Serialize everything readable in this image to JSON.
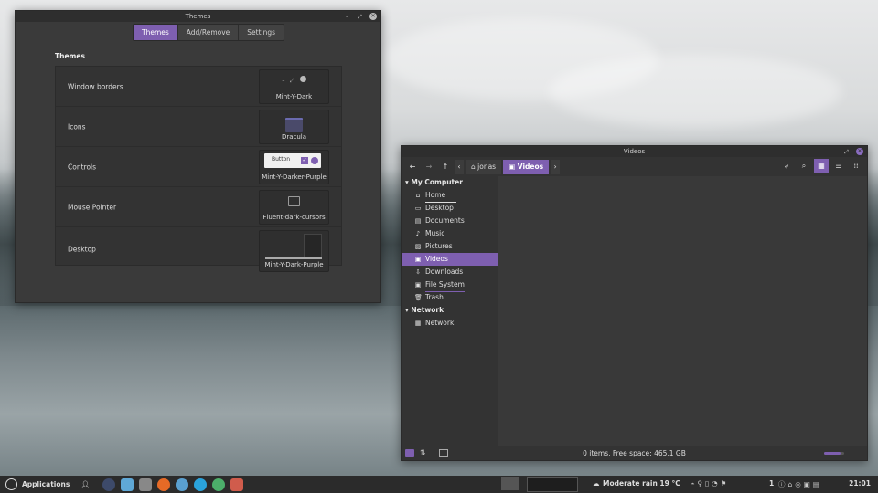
{
  "themes_window": {
    "title": "Themes",
    "tabs": [
      "Themes",
      "Add/Remove",
      "Settings"
    ],
    "section_title": "Themes",
    "rows": [
      {
        "label": "Window borders",
        "value": "Mint-Y-Dark"
      },
      {
        "label": "Icons",
        "value": "Dracula"
      },
      {
        "label": "Controls",
        "value": "Mint-Y-Darker-Purple",
        "preview_button": "Button"
      },
      {
        "label": "Mouse Pointer",
        "value": "Fluent-dark-cursors"
      },
      {
        "label": "Desktop",
        "value": "Mint-Y-Dark-Purple"
      }
    ]
  },
  "files_window": {
    "title": "Videos",
    "breadcrumbs": [
      "jonas",
      "Videos"
    ],
    "sidebar": {
      "sections": [
        {
          "title": "My Computer",
          "items": [
            "Home",
            "Desktop",
            "Documents",
            "Music",
            "Pictures",
            "Videos",
            "Downloads",
            "File System",
            "Trash"
          ]
        },
        {
          "title": "Network",
          "items": [
            "Network"
          ]
        }
      ],
      "active_item": "Videos"
    },
    "status": "0 items, Free space: 465,1 GB"
  },
  "panel": {
    "menu_label": "Applications",
    "weather": "Moderate rain 19 °C",
    "notification_count": "1",
    "clock": "21:01"
  },
  "colors": {
    "accent": "#7e5fb0",
    "panel": "#2b2b2b",
    "window": "#3a3a3a"
  }
}
